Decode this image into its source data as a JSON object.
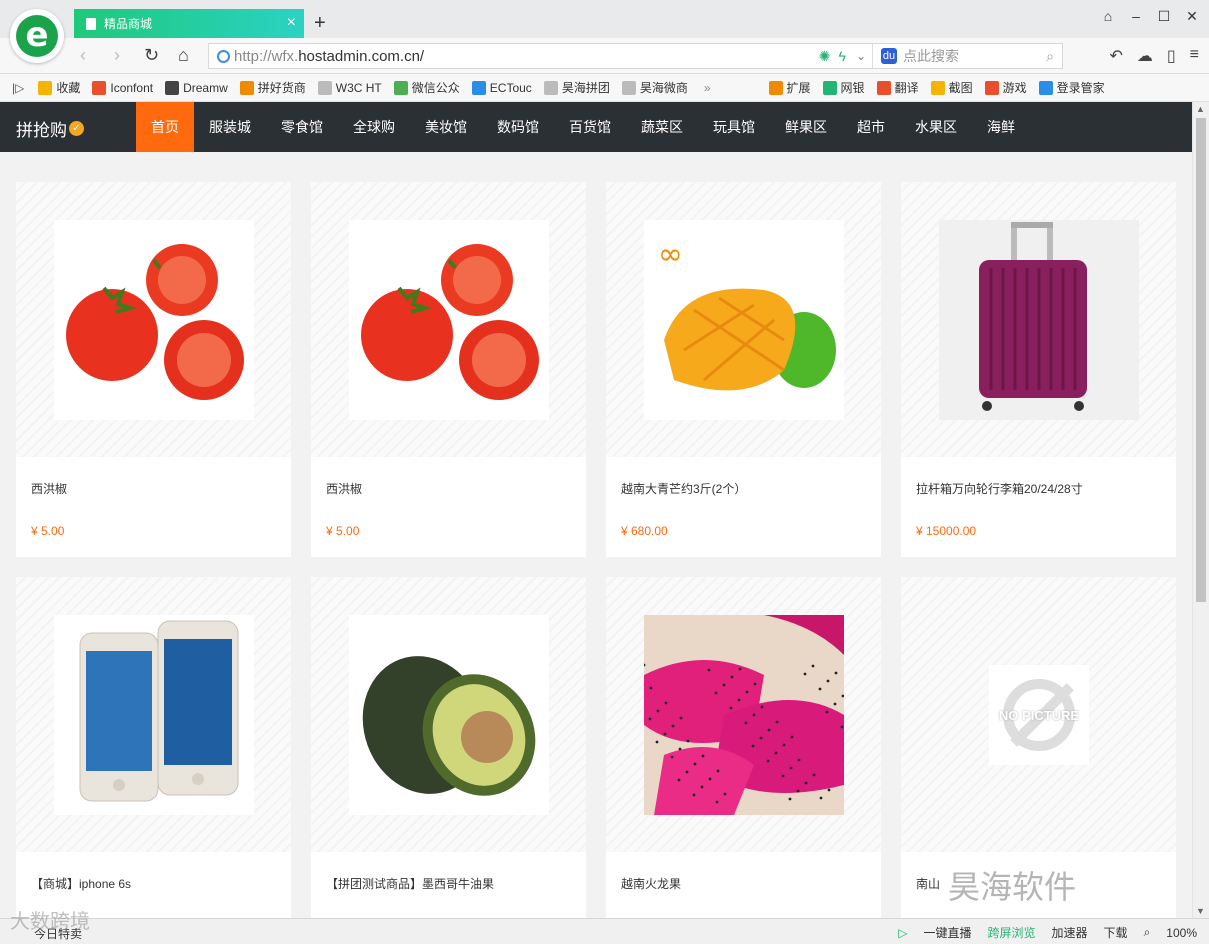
{
  "browser": {
    "tab_title": "精品商城",
    "url_prefix": "http://wfx.",
    "url_host": "hostadmin.com.cn/",
    "search_placeholder": "点此搜索",
    "bookmarks": [
      "收藏",
      "Iconfont",
      "Dreamw",
      "拼好货商",
      "W3C HT",
      "微信公众",
      "ECTouc",
      "昊海拼团",
      "昊海微商"
    ],
    "extras": [
      "扩展",
      "网银",
      "翻译",
      "截图",
      "游戏",
      "登录管家"
    ],
    "status_left": "今日特卖",
    "status_items": [
      "一键直播",
      "跨屏浏览",
      "加速器",
      "下载"
    ],
    "zoom": "100%"
  },
  "site": {
    "brand": "拼抢购",
    "menu": [
      "首页",
      "服装城",
      "零食馆",
      "全球购",
      "美妆馆",
      "数码馆",
      "百货馆",
      "蔬菜区",
      "玩具馆",
      "鲜果区",
      "超市",
      "水果区",
      "海鲜"
    ],
    "active_menu": "首页"
  },
  "products": [
    {
      "name": "西洪椒",
      "price": "¥ 5.00",
      "image": "tomato"
    },
    {
      "name": "西洪椒",
      "price": "¥ 5.00",
      "image": "tomato"
    },
    {
      "name": "越南大青芒约3斤(2个）",
      "price": "¥ 680.00",
      "image": "mango"
    },
    {
      "name": "拉杆箱万向轮行李箱20/24/28寸",
      "price": "¥ 15000.00",
      "image": "suitcase"
    },
    {
      "name": "【商城】iphone 6s",
      "price": "",
      "image": "iphone"
    },
    {
      "name": "【拼团测试商品】墨西哥牛油果",
      "price": "",
      "image": "avocado"
    },
    {
      "name": "越南火龙果",
      "price": "",
      "image": "dragonfruit"
    },
    {
      "name": "南山",
      "price": "",
      "image": "no-picture"
    }
  ],
  "watermarks": [
    "昊海软件",
    "大数跨境"
  ],
  "no_picture_text": "NO PICTURE",
  "colors": {
    "accent": "#ff6a0e",
    "header": "#2b3034",
    "tab": "#1ec979"
  }
}
